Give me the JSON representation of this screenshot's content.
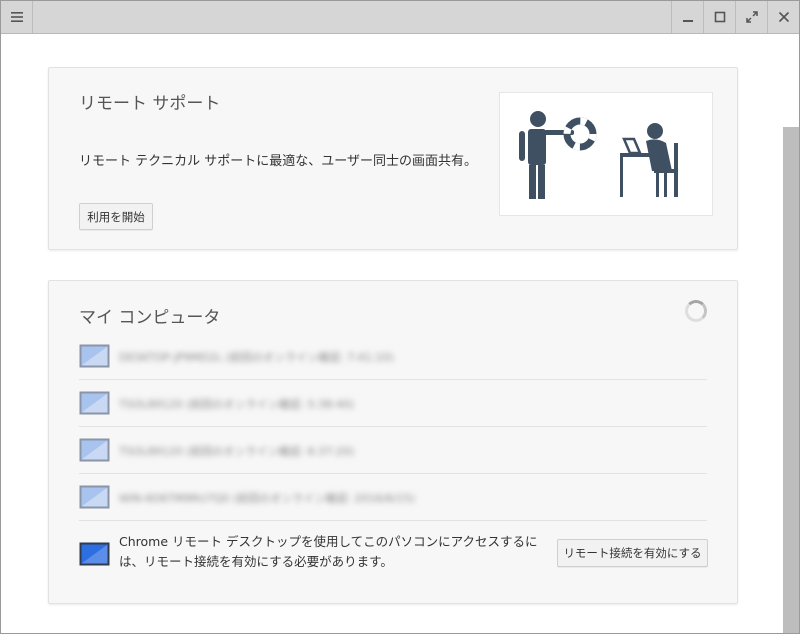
{
  "window": {
    "menu_icon": "hamburger-menu-icon",
    "minimize_icon": "minimize-icon",
    "maximize_icon": "maximize-icon",
    "fullscreen_icon": "fullscreen-icon",
    "close_icon": "close-icon"
  },
  "support": {
    "title": "リモート サポート",
    "description": "リモート テクニカル サポートに最適な、ユーザー同士の画面共有。",
    "start_label": "利用を開始",
    "illustration": "remote-support-illustration"
  },
  "computers": {
    "title": "マイ コンピュータ",
    "status_icon": "loading-spinner-icon",
    "hosts": [
      {
        "name": "DESKTOP-JP9MD2L (前回のオンライン確認: 7:41:10)"
      },
      {
        "name": "TSOL89120 (前回のオンライン確認: 5:38:40)"
      },
      {
        "name": "TSOL89120 (前回のオンライン確認: 6:37:20)"
      },
      {
        "name": "WIN-6D6TM9RU7Q0 (前回のオンライン確認: 2016/6/15)"
      }
    ],
    "local_message": "Chrome リモート デスクトップを使用してこのパソコンにアクセスするには、リモート接続を有効にする必要があります。",
    "enable_label": "リモート接続を有効にする"
  },
  "colors": {
    "titlebar": "#d6d6d6",
    "card": "#f7f7f7",
    "pc_offline": "#8fb1e8",
    "pc_local": "#2d6ee0",
    "figure": "#3f5063"
  }
}
